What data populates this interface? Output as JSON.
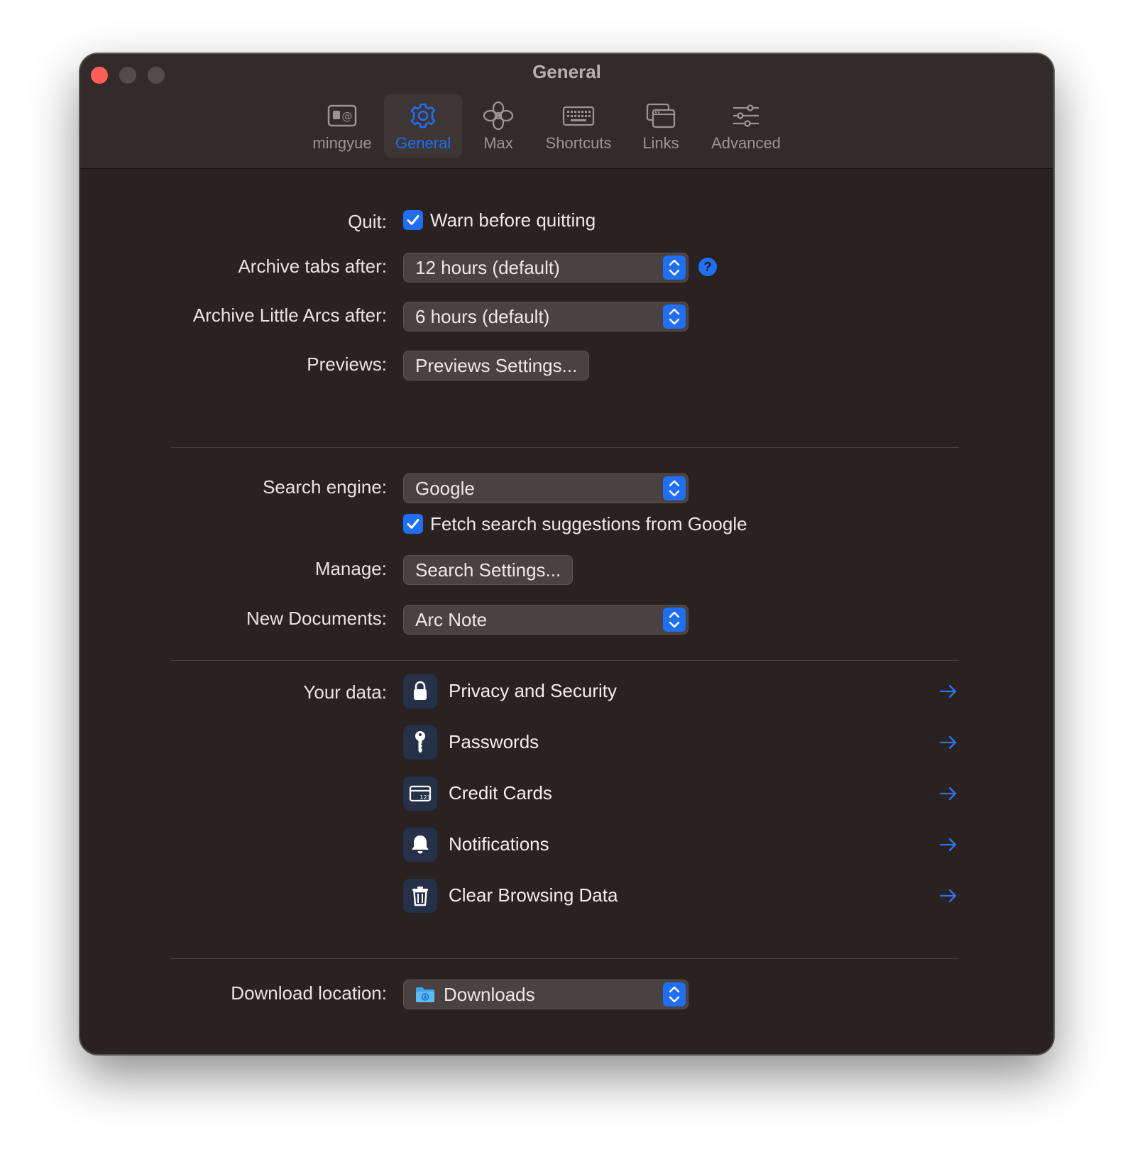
{
  "window": {
    "title": "General"
  },
  "tabs": [
    {
      "label": "mingyue",
      "icon": "contact-card-icon",
      "active": false
    },
    {
      "label": "General",
      "icon": "gear-icon",
      "active": true
    },
    {
      "label": "Max",
      "icon": "flower-icon",
      "active": false
    },
    {
      "label": "Shortcuts",
      "icon": "keyboard-icon",
      "active": false
    },
    {
      "label": "Links",
      "icon": "windows-icon",
      "active": false
    },
    {
      "label": "Advanced",
      "icon": "sliders-icon",
      "active": false
    }
  ],
  "general": {
    "quit_label": "Quit:",
    "warn_before_quitting": {
      "label": "Warn before quitting",
      "checked": true
    },
    "archive_tabs_label": "Archive tabs after:",
    "archive_tabs_value": "12 hours (default)",
    "help_glyph": "?",
    "archive_little_arcs_label": "Archive Little Arcs after:",
    "archive_little_arcs_value": "6 hours (default)",
    "previews_label": "Previews:",
    "previews_button": "Previews Settings..."
  },
  "search": {
    "engine_label": "Search engine:",
    "engine_value": "Google",
    "fetch_suggestions": {
      "label": "Fetch search suggestions from Google",
      "checked": true
    },
    "manage_label": "Manage:",
    "manage_button": "Search Settings...",
    "new_documents_label": "New Documents:",
    "new_documents_value": "Arc Note"
  },
  "your_data": {
    "label": "Your data:",
    "items": [
      {
        "label": "Privacy and Security",
        "icon": "lock-icon"
      },
      {
        "label": "Passwords",
        "icon": "key-icon"
      },
      {
        "label": "Credit Cards",
        "icon": "credit-card-icon"
      },
      {
        "label": "Notifications",
        "icon": "bell-icon"
      },
      {
        "label": "Clear Browsing Data",
        "icon": "trash-icon"
      }
    ]
  },
  "download": {
    "label": "Download location:",
    "value": "Downloads",
    "icon": "downloads-folder-icon"
  },
  "colors": {
    "accent": "#1f6ff4",
    "window_bg": "#2a2220",
    "titlebar_bg": "#332b29",
    "close_button": "#fe5f57"
  }
}
